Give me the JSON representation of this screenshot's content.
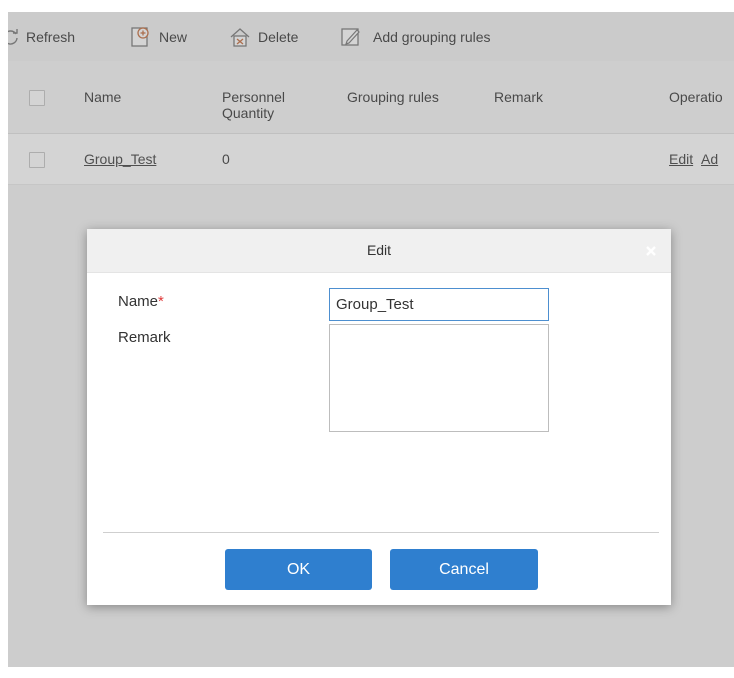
{
  "toolbar": {
    "refresh": {
      "label": "Refresh",
      "icon": "refresh-icon"
    },
    "new": {
      "label": "New",
      "icon": "new-icon"
    },
    "delete": {
      "label": "Delete",
      "icon": "delete-icon"
    },
    "add_grouping": {
      "label": "Add grouping rules",
      "icon": "add-grouping-icon"
    }
  },
  "table": {
    "columns": {
      "name": "Name",
      "personnel_line1": "Personnel",
      "personnel_line2": "Quantity",
      "grouping_rules": "Grouping rules",
      "remark": "Remark",
      "operations": "Operatio"
    },
    "rows": [
      {
        "name": "Group_Test",
        "personnel_quantity": "0",
        "grouping_rules": "",
        "remark": "",
        "op_edit": "Edit",
        "op_add": "Ad"
      }
    ]
  },
  "dialog": {
    "title": "Edit",
    "name_label": "Name",
    "required_mark": "*",
    "name_value": "Group_Test",
    "remark_label": "Remark",
    "remark_value": "",
    "ok_label": "OK",
    "cancel_label": "Cancel"
  },
  "colors": {
    "primary_button": "#2f7fcf",
    "input_focus_border": "#4d8fd0",
    "required": "#e03a3a"
  }
}
